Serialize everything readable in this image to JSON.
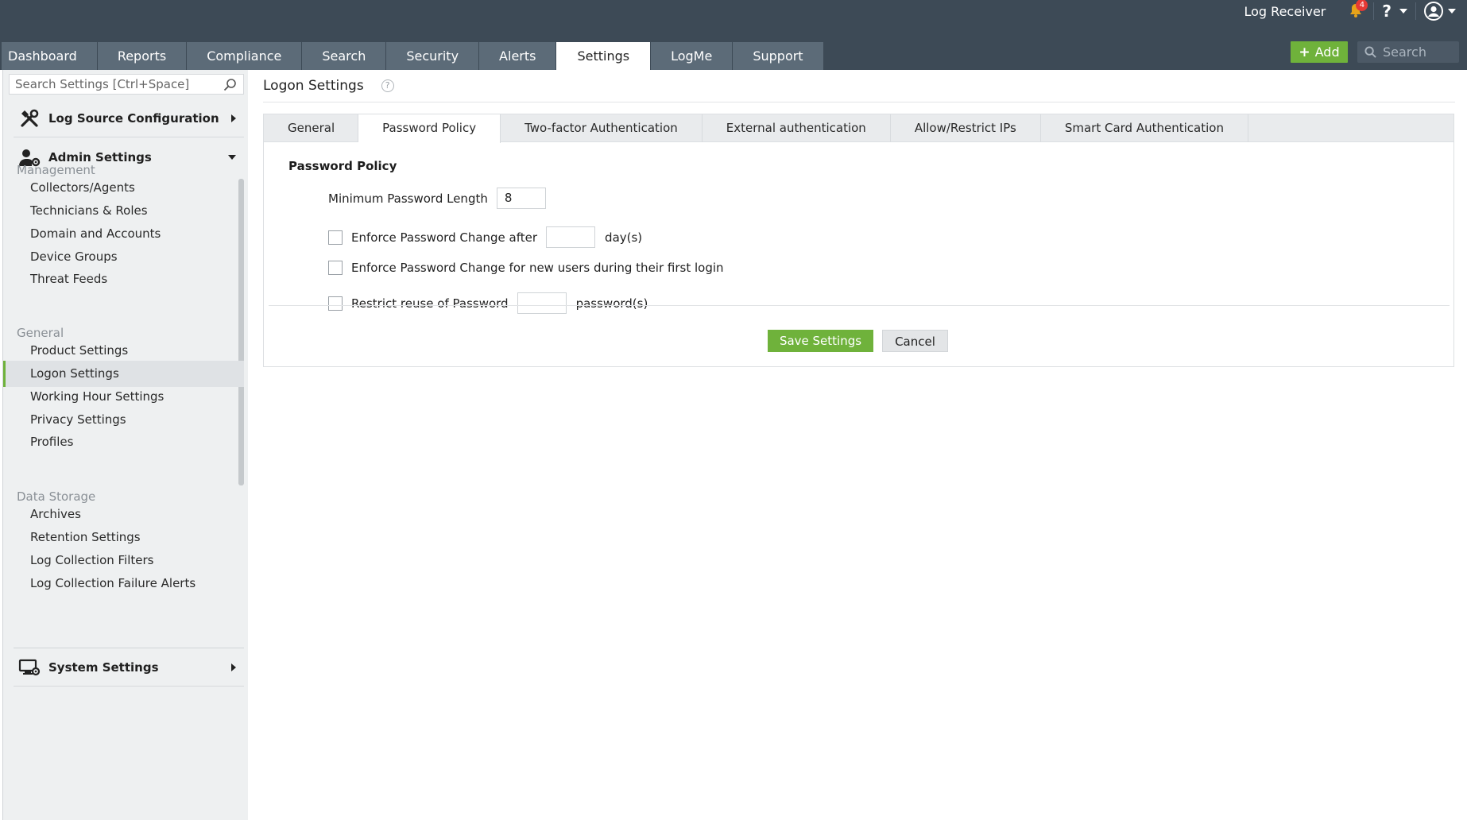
{
  "header": {
    "app_name": "Log Receiver",
    "notification_count": "4",
    "help_label": "?",
    "add_label": "Add",
    "search_placeholder": "Search"
  },
  "nav": {
    "tabs": [
      {
        "label": "Dashboard"
      },
      {
        "label": "Reports"
      },
      {
        "label": "Compliance"
      },
      {
        "label": "Search"
      },
      {
        "label": "Security"
      },
      {
        "label": "Alerts"
      },
      {
        "label": "Settings",
        "active": true
      },
      {
        "label": "LogMe"
      },
      {
        "label": "Support"
      }
    ]
  },
  "sidebar": {
    "search_placeholder": "Search Settings [Ctrl+Space]",
    "sections": {
      "log_source": "Log Source Configuration",
      "admin": "Admin Settings",
      "system": "System Settings"
    },
    "groups": {
      "management": "Management",
      "general": "General",
      "data_storage": "Data Storage"
    },
    "management_items": [
      "Collectors/Agents",
      "Technicians & Roles",
      "Domain and Accounts",
      "Device Groups",
      "Threat Feeds"
    ],
    "general_items": [
      "Product Settings",
      "Logon Settings",
      "Working Hour Settings",
      "Privacy Settings",
      "Profiles"
    ],
    "data_storage_items": [
      "Archives",
      "Retention Settings",
      "Log Collection Filters",
      "Log Collection Failure Alerts"
    ],
    "active_item": "Logon Settings"
  },
  "main": {
    "title": "Logon Settings",
    "help_icon": "?",
    "tabs": [
      "General",
      "Password Policy",
      "Two-factor Authentication",
      "External authentication",
      "Allow/Restrict IPs",
      "Smart Card Authentication"
    ],
    "active_tab": "Password Policy",
    "section_title": "Password Policy",
    "fields": {
      "min_length_label": "Minimum Password Length",
      "min_length_value": "8",
      "enforce_change_label": "Enforce Password Change after",
      "enforce_change_value": "",
      "enforce_change_unit": "day(s)",
      "enforce_change_checked": false,
      "first_login_label": "Enforce Password Change for new users during their first login",
      "first_login_checked": false,
      "restrict_reuse_label": "Restrict reuse of Password",
      "restrict_reuse_value": "",
      "restrict_reuse_unit": "password(s)",
      "restrict_reuse_checked": false
    },
    "save_label": "Save Settings",
    "cancel_label": "Cancel"
  },
  "colors": {
    "topbar": "#3d4a56",
    "nav_tab": "#5c6b78",
    "accent_green": "#6fb23b",
    "sidebar_bg": "#eef0f1"
  }
}
